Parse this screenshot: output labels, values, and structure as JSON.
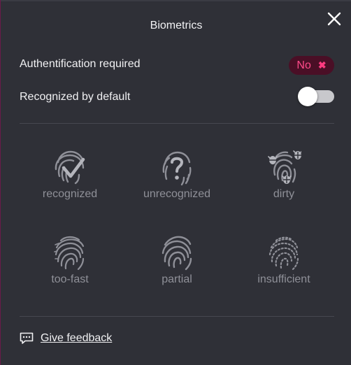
{
  "dialog": {
    "title": "Biometrics"
  },
  "settings": {
    "auth_required_label": "Authentification required",
    "auth_required_value": "No",
    "recognized_default_label": "Recognized by default",
    "recognized_default_on": false
  },
  "tiles": [
    {
      "label": "recognized",
      "icon": "fingerprint-check-icon"
    },
    {
      "label": "unrecognized",
      "icon": "fingerprint-question-icon"
    },
    {
      "label": "dirty",
      "icon": "fingerprint-bugs-icon"
    },
    {
      "label": "too-fast",
      "icon": "fingerprint-blur-icon"
    },
    {
      "label": "partial",
      "icon": "fingerprint-partial-icon"
    },
    {
      "label": "insufficient",
      "icon": "fingerprint-dotted-icon"
    }
  ],
  "footer": {
    "feedback_label": "Give feedback"
  },
  "colors": {
    "panel_bg": "#2f3037",
    "accent": "#ff4a8a",
    "badge_bg": "#4a0f26",
    "tile_icon": "#8f9098"
  }
}
